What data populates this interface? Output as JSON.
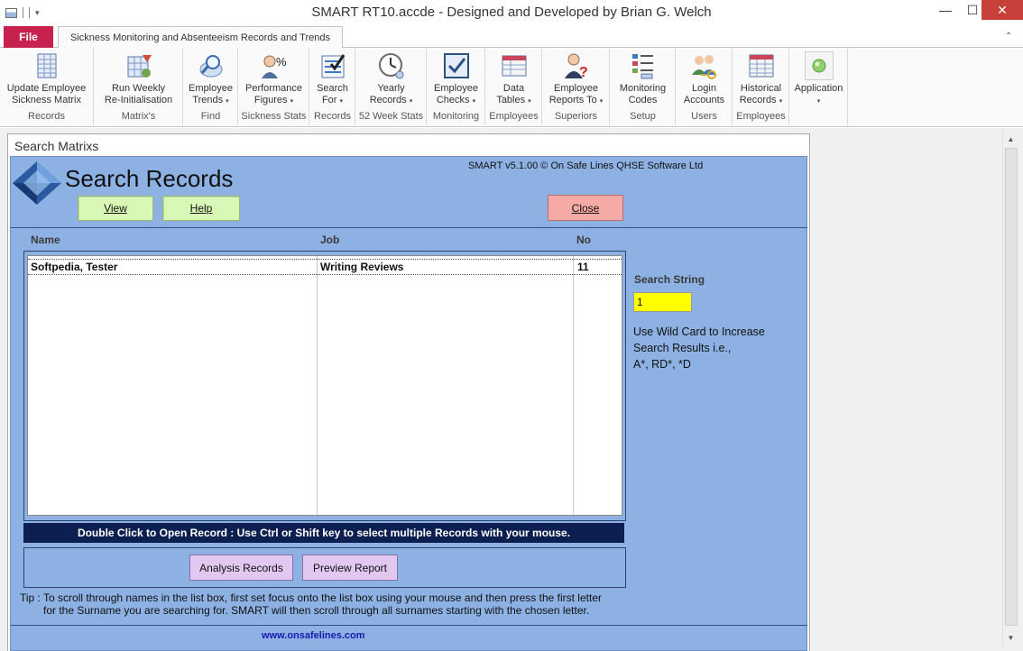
{
  "window": {
    "title": "SMART RT10.accde - Designed and Developed by Brian G. Welch",
    "minimize": "—",
    "maximize": "☐",
    "close": "✕"
  },
  "ribbon": {
    "file_tab": "File",
    "main_tab": "Sickness Monitoring and Absenteeism Records and Trends",
    "collapse_icon": "chevron-up-icon",
    "groups": [
      {
        "label": "Records",
        "button": "Update Employee\nSickness Matrix",
        "icon": "table-icon"
      },
      {
        "label": "Matrix's",
        "button": "Run Weekly\nRe-Initialisation",
        "icon": "refresh-matrix-icon"
      },
      {
        "label": "Find",
        "button": "Employee\nTrends",
        "icon": "find-icon"
      },
      {
        "label": "Sickness Stats",
        "button": "Performance\nFigures",
        "icon": "percent-user-icon"
      },
      {
        "label": "Records",
        "button": "Search\nFor",
        "icon": "checklist-icon"
      },
      {
        "label": "52 Week Stats",
        "button": "Yearly\nRecords",
        "icon": "clock-icon"
      },
      {
        "label": "Monitoring",
        "button": "Employee\nChecks",
        "icon": "checkbox-icon"
      },
      {
        "label": "Employees",
        "button": "Data\nTables",
        "icon": "data-table-icon"
      },
      {
        "label": "Superiors",
        "button": "Employee\nReports To",
        "icon": "user-question-icon"
      },
      {
        "label": "Setup",
        "button": "Monitoring\nCodes",
        "icon": "list-codes-icon"
      },
      {
        "label": "Users",
        "button": "Login\nAccounts",
        "icon": "users-keys-icon"
      },
      {
        "label": "Employees",
        "button": "Historical\nRecords",
        "icon": "history-table-icon"
      },
      {
        "label": "",
        "button": "Application",
        "icon": "application-icon"
      }
    ]
  },
  "form": {
    "tab_title": "Search Matrixs",
    "title": "Search Records",
    "copyright": "SMART v5.1.00 © On Safe Lines QHSE Software Ltd",
    "buttons": {
      "view": "View",
      "help": "Help",
      "close": "Close",
      "analysis": "Analysis Records",
      "preview": "Preview Report"
    },
    "columns": {
      "name": "Name",
      "job": "Job",
      "no": "No"
    },
    "rows": [
      {
        "name": "Softpedia, Tester",
        "job": "Writing Reviews",
        "no": "11"
      }
    ],
    "search_label": "Search String",
    "search_value": "1",
    "wildcard_note_1": "Use Wild Card to Increase",
    "wildcard_note_2": "Search Results i.e.,",
    "wildcard_note_3": "A*, RD*, *D",
    "instruction_bar": "Double Click to Open Record : Use Ctrl or Shift key to select multiple Records with your mouse.",
    "tip_line1": "Tip : To scroll through names in the list box, first set focus onto the list box using your mouse and then press the first letter",
    "tip_line2": "for the Surname you are searching for.  SMART will then scroll through all surnames starting with the chosen letter.",
    "url": "www.onsafelines.com"
  },
  "colors": {
    "form_bg": "#8db1e3",
    "file_tab": "#c6224d",
    "view_help_button": "#d9f7b6",
    "close_button": "#f5aaa6",
    "report_buttons": "#e2c8f0",
    "search_input": "#ffff00",
    "instruction_bar": "#0c1f50"
  }
}
